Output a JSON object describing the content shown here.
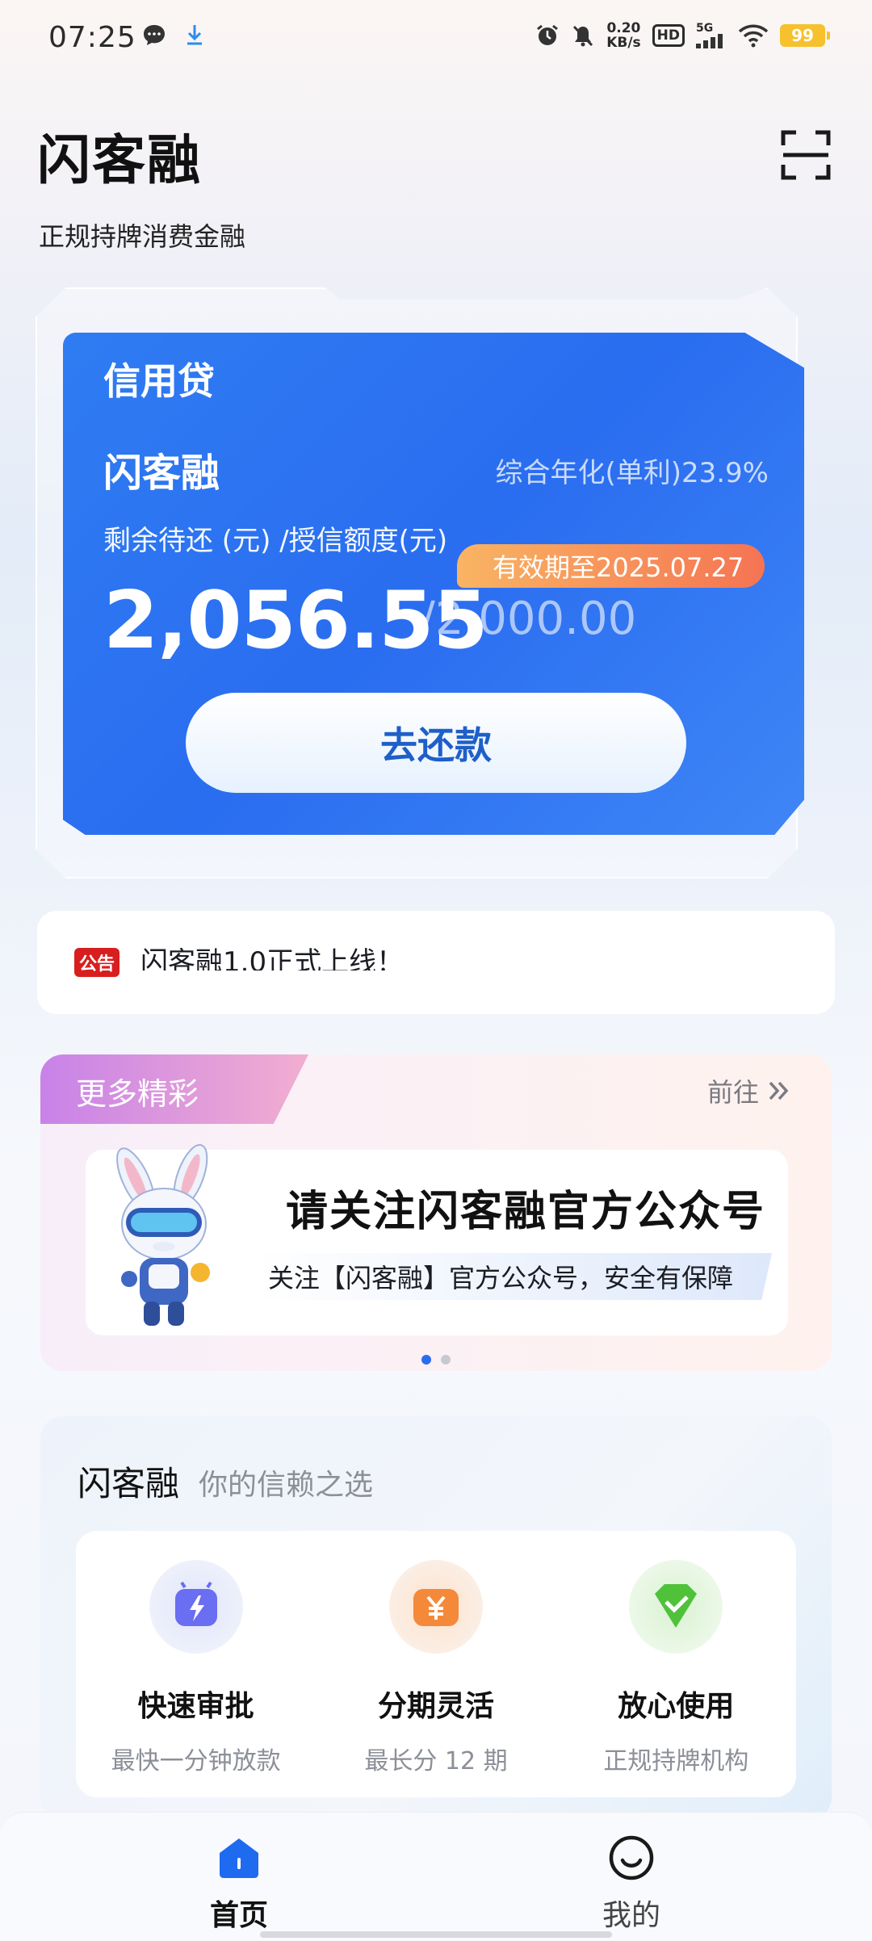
{
  "status_bar": {
    "time": "07:25",
    "net_speed_value": "0.20",
    "net_speed_unit": "KB/s",
    "hd": "HD",
    "network": "5G",
    "battery": "99"
  },
  "header": {
    "brand": "闪客融",
    "subtitle": "正规持牌消费金融"
  },
  "credit_card": {
    "type": "信用贷",
    "product": "闪客融",
    "rate": "综合年化(单利)23.9%",
    "amount_label": "剩余待还 (元) /授信额度(元)",
    "validity": "有效期至2025.07.27",
    "outstanding": "2,056.55",
    "limit": "/2,000.00",
    "repay_button": "去还款"
  },
  "notice": {
    "badge": "公告",
    "text": "闪客融1.0正式上线！"
  },
  "more": {
    "tab_label": "更多精彩",
    "link": "前往",
    "banner_title": "请关注闪客融官方公众号",
    "banner_subtitle": "关注【闪客融】官方公众号，安全有保障",
    "page_count": 2,
    "active_page": 1
  },
  "trust": {
    "title": "闪客融",
    "slogan": "你的信赖之选",
    "features": [
      {
        "title": "快速审批",
        "desc": "最快一分钟放款",
        "icon": "lightning-icon"
      },
      {
        "title": "分期灵活",
        "desc": "最长分 12 期",
        "icon": "yuan-icon"
      },
      {
        "title": "放心使用",
        "desc": "正规持牌机构",
        "icon": "shield-check-icon"
      }
    ]
  },
  "bottom_nav": {
    "home": "首页",
    "mine": "我的"
  },
  "colors": {
    "card_blue": "#2a6df0",
    "badge_orange": "#f57453",
    "notice_red": "#d81e1e"
  }
}
